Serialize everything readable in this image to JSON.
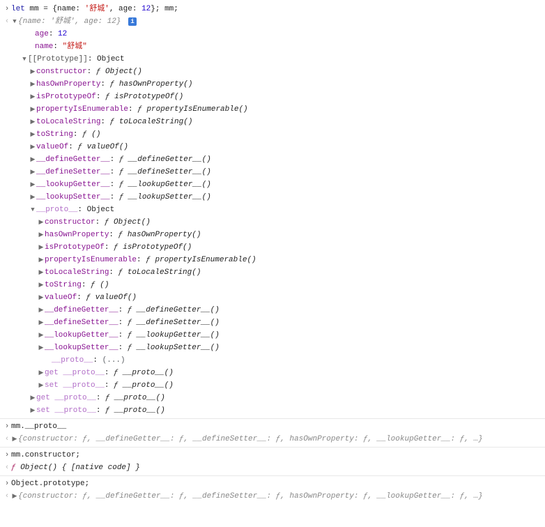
{
  "input1": {
    "text_pre": "let",
    "var": " mm ",
    "eq": "= {name: ",
    "str": "'舒城'",
    "mid": ", age: ",
    "num": "12",
    "post": "}; mm;"
  },
  "out1_head": {
    "open": "{",
    "k1": "name",
    "v1": "'舒城'",
    "k2": "age",
    "v2": "12",
    "close": "}"
  },
  "out1_tree": {
    "age_k": "age",
    "age_v": "12",
    "name_k": "name",
    "name_v": "\"舒城\"",
    "proto_label": "[[Prototype]]",
    "proto_val": "Object",
    "proto2_label": "__proto__",
    "proto2_val": "Object",
    "proto3_label": "__proto__",
    "proto3_val": "(...)",
    "props": [
      {
        "k": "constructor",
        "v": "Object()"
      },
      {
        "k": "hasOwnProperty",
        "v": "hasOwnProperty()"
      },
      {
        "k": "isPrototypeOf",
        "v": "isPrototypeOf()"
      },
      {
        "k": "propertyIsEnumerable",
        "v": "propertyIsEnumerable()"
      },
      {
        "k": "toLocaleString",
        "v": "toLocaleString()"
      },
      {
        "k": "toString",
        "v": "()"
      },
      {
        "k": "valueOf",
        "v": "valueOf()"
      },
      {
        "k": "__defineGetter__",
        "v": "__defineGetter__()"
      },
      {
        "k": "__defineSetter__",
        "v": "__defineSetter__()"
      },
      {
        "k": "__lookupGetter__",
        "v": "__lookupGetter__()"
      },
      {
        "k": "__lookupSetter__",
        "v": "__lookupSetter__()"
      }
    ],
    "props2": [
      {
        "k": "constructor",
        "v": "Object()"
      },
      {
        "k": "hasOwnProperty",
        "v": "hasOwnProperty()"
      },
      {
        "k": "isPrototypeOf",
        "v": "isPrototypeOf()"
      },
      {
        "k": "propertyIsEnumerable",
        "v": "propertyIsEnumerable()"
      },
      {
        "k": "toLocaleString",
        "v": "toLocaleString()"
      },
      {
        "k": "toString",
        "v": "()"
      },
      {
        "k": "valueOf",
        "v": "valueOf()"
      },
      {
        "k": "__defineGetter__",
        "v": "__defineGetter__()"
      },
      {
        "k": "__defineSetter__",
        "v": "__defineSetter__()"
      },
      {
        "k": "__lookupGetter__",
        "v": "__lookupGetter__()"
      },
      {
        "k": "__lookupSetter__",
        "v": "__lookupSetter__()"
      }
    ],
    "getset2": [
      {
        "pre": "get ",
        "k": "__proto__",
        "v": "__proto__()"
      },
      {
        "pre": "set ",
        "k": "__proto__",
        "v": "__proto__()"
      }
    ],
    "getset1": [
      {
        "pre": "get ",
        "k": "__proto__",
        "v": "__proto__()"
      },
      {
        "pre": "set ",
        "k": "__proto__",
        "v": "__proto__()"
      }
    ],
    "f": "ƒ"
  },
  "input2": "mm.__proto__",
  "out2": "{constructor: ƒ, __defineGetter__: ƒ, __defineSetter__: ƒ, hasOwnProperty: ƒ, __lookupGetter__: ƒ, …}",
  "input3": "mm.constructor;",
  "out3_pre": "ƒ",
  "out3_rest": " Object() { [native code] }",
  "input4": "Object.prototype;",
  "out4": "{constructor: ƒ, __defineGetter__: ƒ, __defineSetter__: ƒ, hasOwnProperty: ƒ, __lookupGetter__: ƒ, …}"
}
